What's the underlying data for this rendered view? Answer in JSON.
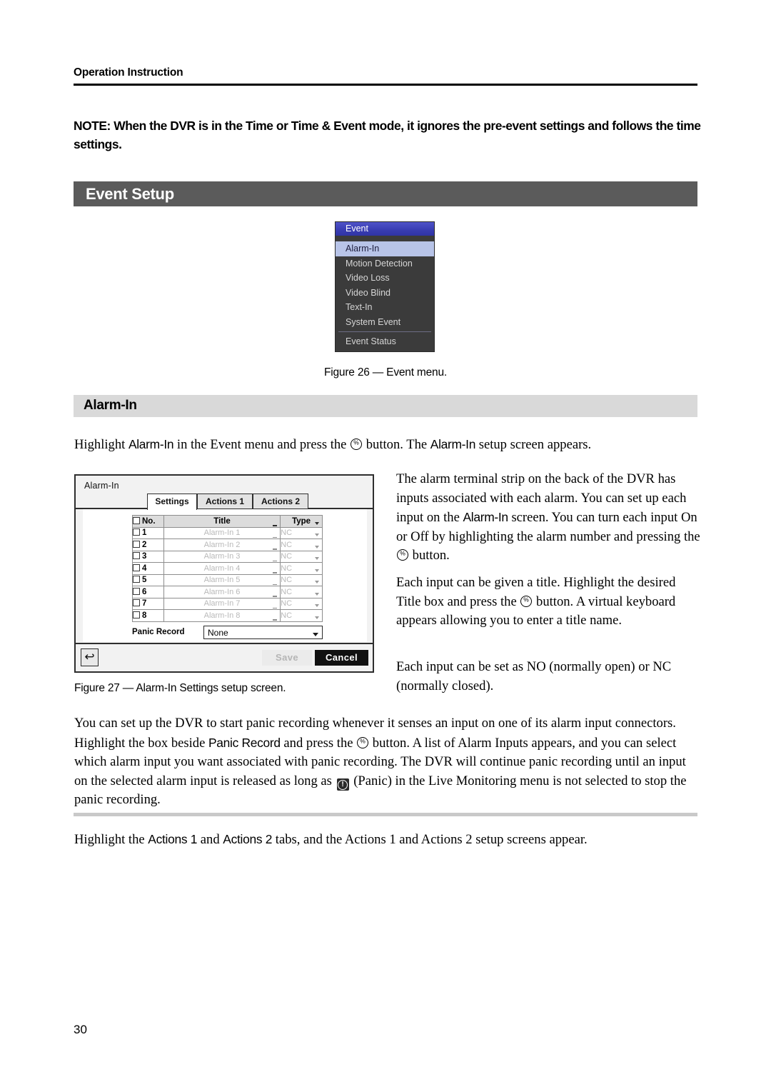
{
  "document": {
    "running_header": "Operation Instruction",
    "page_number": "30"
  },
  "note": {
    "text": "NOTE:  When the DVR is in the Time or Time & Event mode, it ignores the pre-event settings and follows the time settings."
  },
  "section": {
    "banner_title": "Event Setup",
    "subsection_title": "Alarm-In"
  },
  "event_menu": {
    "title": "Event",
    "items": [
      {
        "label": "Alarm-In",
        "selected": true
      },
      {
        "label": "Motion Detection",
        "selected": false
      },
      {
        "label": "Video Loss",
        "selected": false
      },
      {
        "label": "Video Blind",
        "selected": false
      },
      {
        "label": "Text-In",
        "selected": false
      },
      {
        "label": "System Event",
        "selected": false
      }
    ],
    "footer_item": "Event Status"
  },
  "figures": {
    "fig26_caption": "Figure 26 — Event menu.",
    "fig27_caption": "Figure 27 — Alarm-In Settings setup screen."
  },
  "paragraphs": {
    "highlight_intro_a": "Highlight ",
    "highlight_intro_alarmin1": "Alarm-In",
    "highlight_intro_b": " in the Event menu and press the ",
    "highlight_intro_c": " button.  The ",
    "highlight_intro_alarmin2": "Alarm-In",
    "highlight_intro_d": " setup screen appears.",
    "right_1_a": "The alarm terminal strip on the back of the DVR has inputs associated with each alarm.  You can set up each input on the ",
    "right_1_alarmin": "Alarm-In",
    "right_1_b": " screen.  You can turn each input On or Off by highlighting the alarm number and pressing the ",
    "right_1_c": " button.",
    "right_2_a": "Each input can be given a title.  Highlight the desired Title box and press the ",
    "right_2_b": " button.  A virtual keyboard appears allowing you to enter a title name.",
    "right_3": "Each input can be set as NO (normally open) or NC (normally closed).",
    "panic_a": "You can set up the DVR to start panic recording whenever it senses an input on one of its alarm input connectors.  Highlight the box beside ",
    "panic_label_inline": "Panic Record",
    "panic_b": " and press the ",
    "panic_c": " button.  A list of Alarm Inputs appears, and you can select which alarm input you want associated with panic recording.  The DVR will continue panic recording until an input on the selected alarm input is released as long as ",
    "panic_d": " (Panic) in the Live Monitoring menu is not selected to stop the panic recording.",
    "actions_a": "Highlight the ",
    "actions_tab1": "Actions 1",
    "actions_b": " and ",
    "actions_tab2": "Actions 2",
    "actions_c": " tabs, and the Actions 1 and Actions 2 setup screens appear."
  },
  "alarm_dialog": {
    "title": "Alarm-In",
    "tabs": [
      {
        "label": "Settings",
        "active": true
      },
      {
        "label": "Actions 1",
        "active": false
      },
      {
        "label": "Actions 2",
        "active": false
      }
    ],
    "table": {
      "headers": {
        "no": "No.",
        "title": "Title",
        "type": "Type"
      },
      "rows": [
        {
          "no": "1",
          "title": "Alarm-In 1",
          "type": "NC"
        },
        {
          "no": "2",
          "title": "Alarm-In 2",
          "type": "NC"
        },
        {
          "no": "3",
          "title": "Alarm-In 3",
          "type": "NC"
        },
        {
          "no": "4",
          "title": "Alarm-In 4",
          "type": "NC"
        },
        {
          "no": "5",
          "title": "Alarm-In 5",
          "type": "NC"
        },
        {
          "no": "6",
          "title": "Alarm-In 6",
          "type": "NC"
        },
        {
          "no": "7",
          "title": "Alarm-In 7",
          "type": "NC"
        },
        {
          "no": "8",
          "title": "Alarm-In 8",
          "type": "NC"
        }
      ]
    },
    "panic_record": {
      "label": "Panic Record",
      "value": "None"
    },
    "footer": {
      "back_icon": "↩",
      "save_label": "Save",
      "cancel_label": "Cancel"
    }
  },
  "colors": {
    "banner_bg": "#5b5b5b",
    "subbanner_bg": "#d9d9d9",
    "menu_bg": "#3b3b3b",
    "menu_title_bg": "#3a3eb4",
    "menu_selected_bg": "#b8c4e8",
    "cancel_bg": "#111111"
  }
}
